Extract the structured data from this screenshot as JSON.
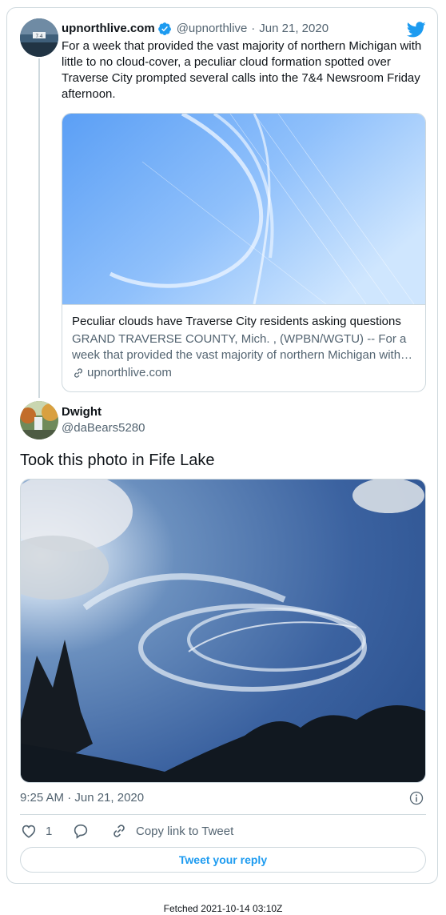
{
  "quoted_tweet": {
    "author_name": "upnorthlive.com",
    "author_handle": "@upnorthlive",
    "separator": "·",
    "date": "Jun 21, 2020",
    "verified": true,
    "text": "For a week that provided the vast majority of northern Michigan with little to no cloud-cover, a peculiar cloud formation spotted over Traverse City prompted several calls into the 7&4 Newsroom Friday afternoon.",
    "link_card": {
      "title": "Peculiar clouds have Traverse City residents asking questions",
      "description": "GRAND TRAVERSE COUNTY, Mich. , (WPBN/WGTU) -- For a week that provided the vast majority of northern Michigan with…",
      "domain": "upnorthlive.com"
    }
  },
  "main_tweet": {
    "author_name": "Dwight",
    "author_handle": "@daBears5280",
    "text": "Took this photo in Fife Lake",
    "timestamp": "9:25 AM · Jun 21, 2020",
    "like_count": "1",
    "copy_link_label": "Copy link to Tweet",
    "reply_button_label": "Tweet your reply"
  },
  "footer": {
    "fetched": "Fetched 2021-10-14 03:10Z"
  },
  "colors": {
    "accent": "#1d9bf0",
    "text": "#0f1419",
    "secondary": "#536471",
    "border": "#cfd9de"
  },
  "icons": [
    "twitter-bird-icon",
    "verified-badge-icon",
    "link-icon",
    "info-icon",
    "heart-icon",
    "reply-icon",
    "copy-link-icon"
  ]
}
